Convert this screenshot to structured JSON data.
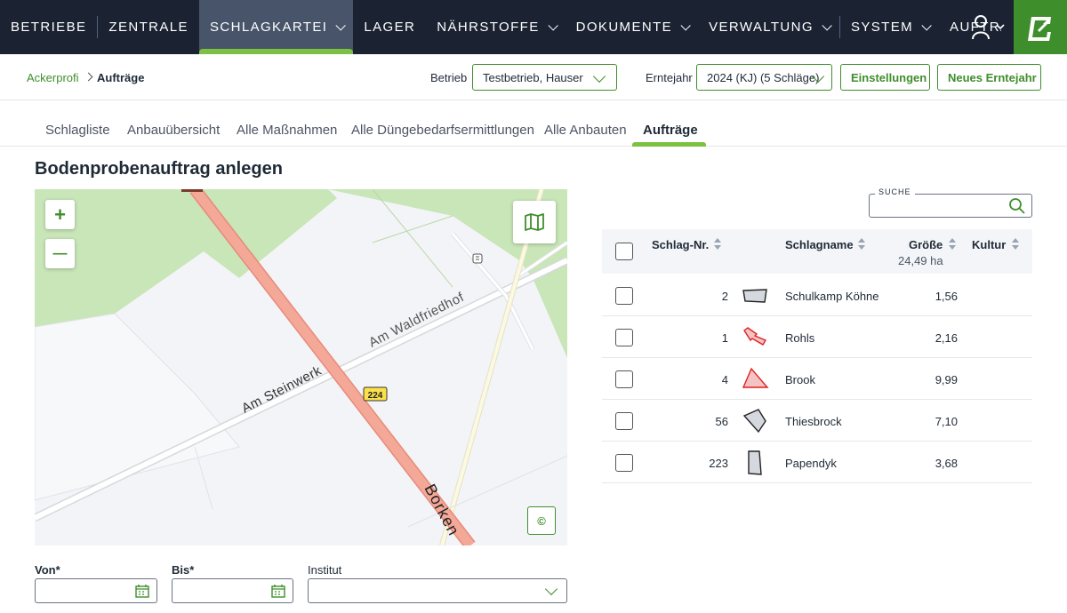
{
  "nav": {
    "items": [
      {
        "label": "BETRIEBE",
        "chevron": false
      },
      {
        "label": "ZENTRALE",
        "chevron": false
      },
      {
        "label": "SCHLAGKARTEI",
        "chevron": true
      },
      {
        "label": "LAGER",
        "chevron": false
      },
      {
        "label": "NÄHRSTOFFE",
        "chevron": true
      },
      {
        "label": "DOKUMENTE",
        "chevron": true
      },
      {
        "label": "VERWALTUNG",
        "chevron": true
      },
      {
        "label": "SYSTEM",
        "chevron": true
      },
      {
        "label": "AUFTRÄGE",
        "chevron": false
      }
    ],
    "active_index": 2
  },
  "breadcrumb": {
    "parent": "Ackerprofi",
    "current": "Aufträge"
  },
  "filters": {
    "betrieb_label": "Betrieb",
    "betrieb_value": "Testbetrieb, Hauser",
    "erntejahr_label": "Erntejahr",
    "erntejahr_value": "2024 (KJ) (5 Schläge)",
    "settings_button": "Einstellungen",
    "new_year_button": "Neues Erntejahr"
  },
  "tabs": [
    {
      "label": "Schlagliste",
      "active": false
    },
    {
      "label": "Anbauübersicht",
      "active": false
    },
    {
      "label": "Alle Maßnahmen",
      "active": false
    },
    {
      "label": "Alle Düngebedarfsermittlungen",
      "active": false
    },
    {
      "label": "Alle Anbauten",
      "active": false
    },
    {
      "label": "Aufträge",
      "active": true
    }
  ],
  "page_title": "Bodenprobenauftrag anlegen",
  "map": {
    "zoom_in": "+",
    "zoom_out": "—",
    "copyright": "©",
    "labels": {
      "street1": "Am Steinwerk",
      "street2": "Am Waldfriedhof",
      "road_number": "224",
      "road_name": "Borken"
    }
  },
  "form": {
    "von_label": "Von*",
    "bis_label": "Bis*",
    "institut_label": "Institut"
  },
  "search": {
    "label": "SUCHE"
  },
  "table": {
    "headers": {
      "nr": "Schlag-Nr.",
      "name": "Schlagname",
      "size": "Größe",
      "size_total": "24,49 ha",
      "crop": "Kultur"
    },
    "rows": [
      {
        "nr": "2",
        "name": "Schulkamp Köhne",
        "size": "1,56",
        "shape": "schulkamp"
      },
      {
        "nr": "1",
        "name": "Rohls",
        "size": "2,16",
        "shape": "rohls"
      },
      {
        "nr": "4",
        "name": "Brook",
        "size": "9,99",
        "shape": "brook"
      },
      {
        "nr": "56",
        "name": "Thiesbrock",
        "size": "7,10",
        "shape": "thiesbrock"
      },
      {
        "nr": "223",
        "name": "Papendyk",
        "size": "3,68",
        "shape": "papendyk"
      }
    ]
  },
  "colors": {
    "brand_green": "#3f8e2c",
    "accent_green": "#7cc142",
    "nav_bg": "#1b2333",
    "road_red": "#f2a394"
  }
}
